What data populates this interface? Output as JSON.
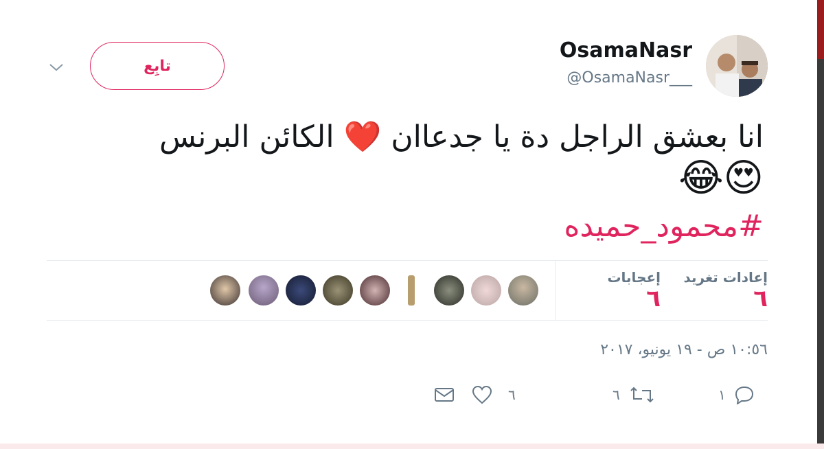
{
  "user": {
    "display_name": "OsamaNasr",
    "handle": "@OsamaNasr___"
  },
  "follow_button": {
    "label": "تابِع"
  },
  "tweet": {
    "text_line1": "انا بعشق الراجل دة يا جدعاان ❤️ الكائن البرنس",
    "emoji_line": "😍😂",
    "hashtag": "#محمود_حميده"
  },
  "stats": {
    "retweets_label": "إعادات تغريد",
    "retweets_count": "٦",
    "likes_label": "إعجابات",
    "likes_count": "٦"
  },
  "timestamp": "١٠:٥٦ ص - ١٩ يونيو، ٢٠١٧",
  "actions": {
    "reply_count": "١",
    "retweet_count": "٦",
    "like_count": "٦"
  },
  "icons": [
    "chevron-down-icon",
    "reply-icon",
    "retweet-icon",
    "heart-icon",
    "message-icon"
  ],
  "colors": {
    "accent": "#e0245e",
    "text": "#14171a",
    "muted": "#657786",
    "divider": "#e6ecf0"
  }
}
